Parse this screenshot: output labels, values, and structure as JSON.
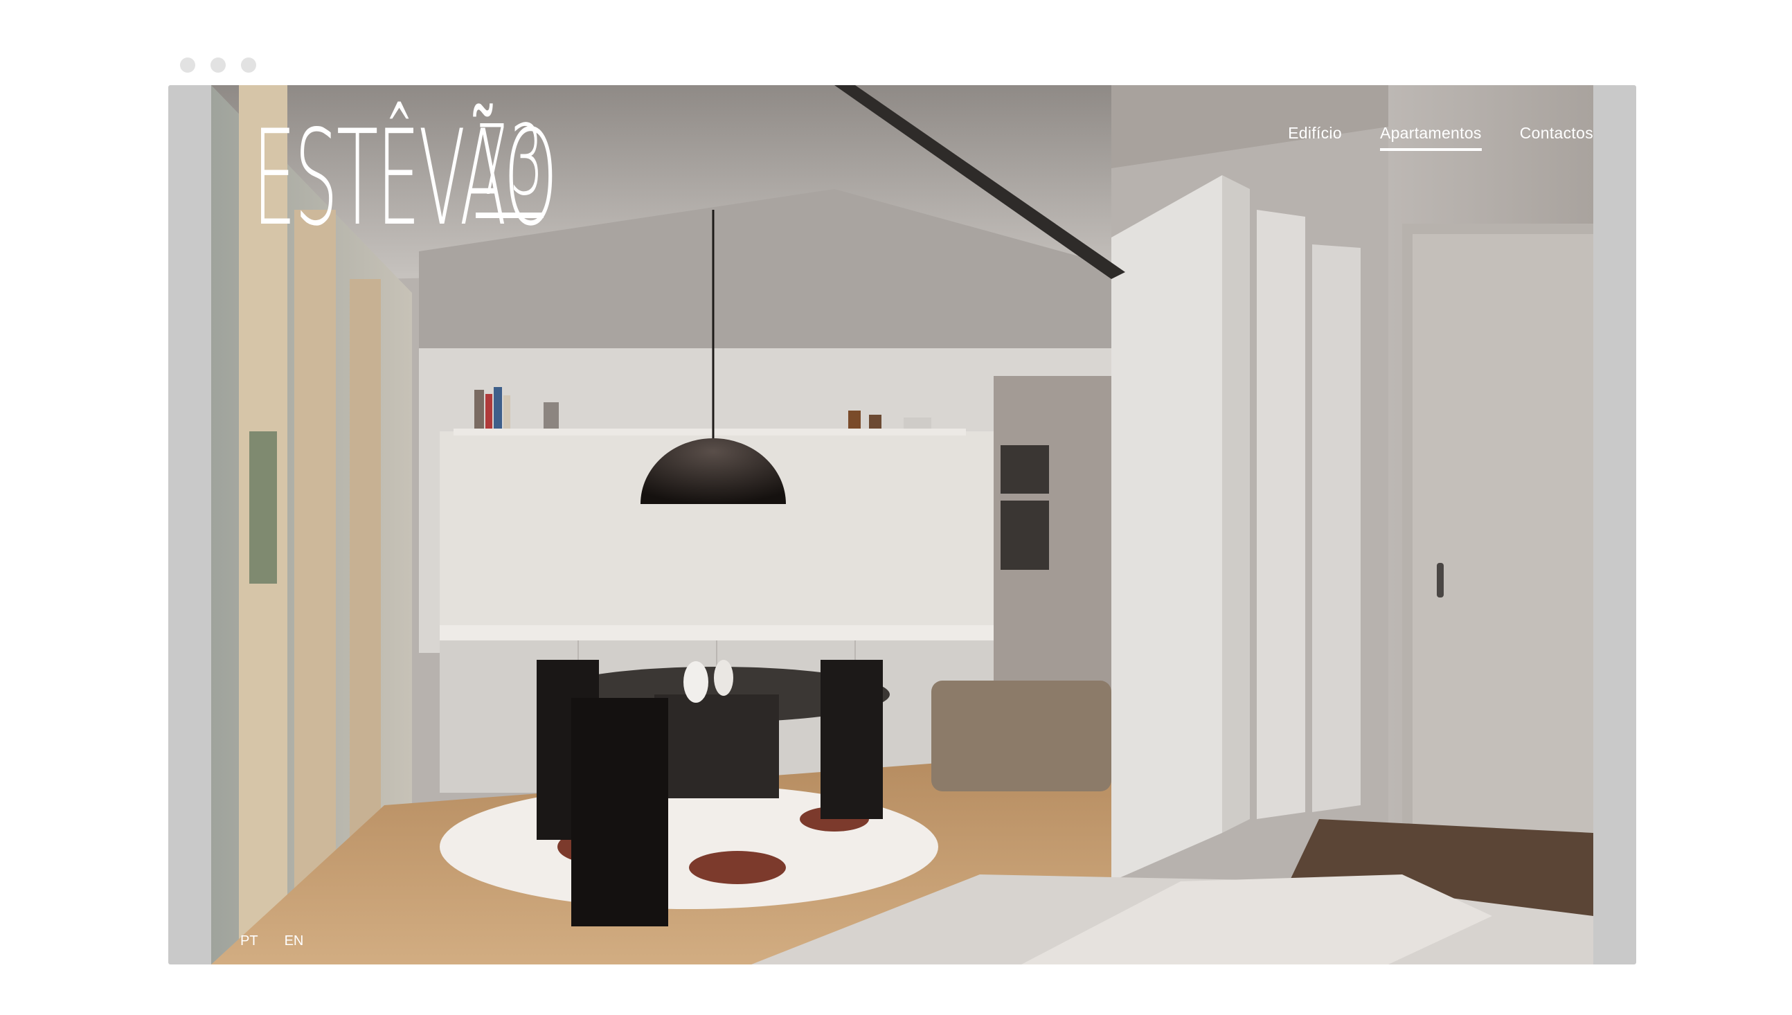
{
  "browser": {
    "controls": [
      "close-dot",
      "minimize-dot",
      "maximize-dot"
    ]
  },
  "site": {
    "logo_word": "ESTÊVÃO",
    "logo_number": "73"
  },
  "nav": {
    "items": [
      {
        "label": "Edifício",
        "active": false
      },
      {
        "label": "Apartamentos",
        "active": true
      },
      {
        "label": "Contactos",
        "active": false
      }
    ]
  },
  "language": {
    "options": [
      "PT",
      "EN"
    ],
    "selected": "PT"
  },
  "colors": {
    "frame": "#c9c9c9",
    "nav_text": "#ffffff",
    "dot": "#e2e2e2"
  },
  "hero": {
    "image_subject": "apartment-interior-render"
  }
}
